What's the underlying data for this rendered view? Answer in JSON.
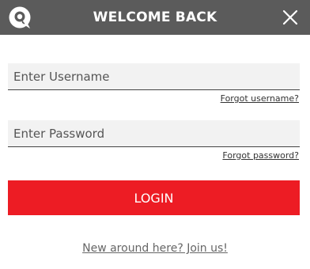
{
  "header": {
    "title": "WELCOME BACK",
    "logo_icon": "chat-bubble-q-logo-icon",
    "close_icon": "close-icon"
  },
  "form": {
    "username": {
      "value": "",
      "placeholder": "Enter Username"
    },
    "password": {
      "value": "",
      "placeholder": "Enter Password"
    },
    "forgot_username": "Forgot username?",
    "forgot_password": "Forgot password?",
    "login_label": "LOGIN"
  },
  "footer": {
    "join_link": "New around here? Join us!"
  },
  "colors": {
    "header_bg": "#5b5b5b",
    "accent": "#ed1c24",
    "field_bg": "#f2f2f2"
  }
}
